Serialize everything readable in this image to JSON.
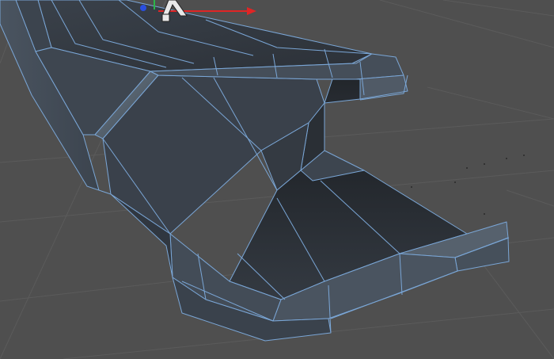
{
  "viewport": {
    "type": "3d-editor-viewport",
    "view": "perspective",
    "background_color": "#4f4f4f",
    "grid_line_color": "#5d5d5d",
    "mesh": {
      "name": "",
      "face_colors": [
        "#2f343b",
        "#3a414a",
        "#464f5b",
        "#586470"
      ],
      "wire_color": "#7aa6d6",
      "selected_outline": false
    },
    "gizmo": {
      "x_axis_color": "#e02525",
      "y_axis_color": "#2bb54a",
      "z_axis_color": "#2a4fe0",
      "center_icon": "move-tool-icon"
    }
  }
}
